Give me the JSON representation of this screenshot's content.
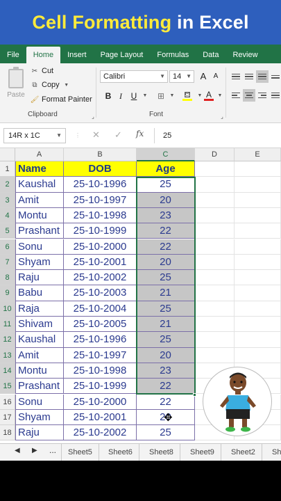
{
  "banner": {
    "title_highlight": "Cell Formatting",
    "title_rest": " in Excel"
  },
  "ribbon_tabs": [
    "File",
    "Home",
    "Insert",
    "Page Layout",
    "Formulas",
    "Data",
    "Review"
  ],
  "active_tab": "Home",
  "clipboard": {
    "paste": "Paste",
    "cut": "Cut",
    "copy": "Copy",
    "format_painter": "Format Painter",
    "group_label": "Clipboard"
  },
  "font": {
    "name": "Calibri",
    "size": "14",
    "grow": "A",
    "shrink": "A",
    "bold": "B",
    "italic": "I",
    "underline": "U",
    "font_color_letter": "A",
    "group_label": "Font"
  },
  "formula_bar": {
    "name_box": "14R x 1C",
    "cancel": "✕",
    "enter": "✓",
    "fx": "fx",
    "value": "25"
  },
  "columns": [
    "A",
    "B",
    "C",
    "D",
    "E"
  ],
  "headers": {
    "name": "Name",
    "dob": "DOB",
    "age": "Age"
  },
  "rows": [
    {
      "num": "1"
    },
    {
      "num": "2",
      "name": "Kaushal",
      "dob": "25-10-1996",
      "age": "25"
    },
    {
      "num": "3",
      "name": "Amit",
      "dob": "25-10-1997",
      "age": "20"
    },
    {
      "num": "4",
      "name": "Montu",
      "dob": "25-10-1998",
      "age": "23"
    },
    {
      "num": "5",
      "name": "Prashant",
      "dob": "25-10-1999",
      "age": "22"
    },
    {
      "num": "6",
      "name": "Sonu",
      "dob": "25-10-2000",
      "age": "22"
    },
    {
      "num": "7",
      "name": "Shyam",
      "dob": "25-10-2001",
      "age": "20"
    },
    {
      "num": "8",
      "name": "Raju",
      "dob": "25-10-2002",
      "age": "25"
    },
    {
      "num": "9",
      "name": "Babu",
      "dob": "25-10-2003",
      "age": "21"
    },
    {
      "num": "10",
      "name": "Raja",
      "dob": "25-10-2004",
      "age": "25"
    },
    {
      "num": "11",
      "name": "Shivam",
      "dob": "25-10-2005",
      "age": "21"
    },
    {
      "num": "12",
      "name": "Kaushal",
      "dob": "25-10-1996",
      "age": "25"
    },
    {
      "num": "13",
      "name": "Amit",
      "dob": "25-10-1997",
      "age": "20"
    },
    {
      "num": "14",
      "name": "Montu",
      "dob": "25-10-1998",
      "age": "23"
    },
    {
      "num": "15",
      "name": "Prashant",
      "dob": "25-10-1999",
      "age": "22"
    },
    {
      "num": "16",
      "name": "Sonu",
      "dob": "25-10-2000",
      "age": "22"
    },
    {
      "num": "17",
      "name": "Shyam",
      "dob": "25-10-2001",
      "age": "20"
    },
    {
      "num": "18",
      "name": "Raju",
      "dob": "25-10-2002",
      "age": "25"
    }
  ],
  "sheet_nav": {
    "prev": "◀",
    "next": "▶",
    "more": "..."
  },
  "sheets": [
    "Sheet5",
    "Sheet6",
    "Sheet8",
    "Sheet9",
    "Sheet2",
    "She"
  ],
  "colors": {
    "accent": "#217346",
    "banner": "#2e5fbd",
    "header_fill": "#ffff00",
    "selection_fill": "#c6c6c6"
  }
}
